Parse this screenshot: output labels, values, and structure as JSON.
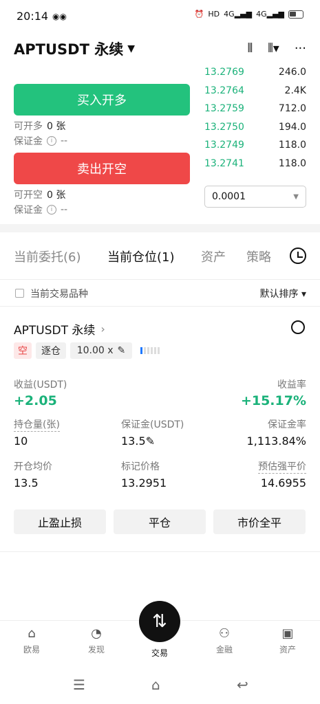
{
  "status": {
    "time": "20:14",
    "net1": "4G",
    "net2": "4G",
    "hd": "HD"
  },
  "header": {
    "pair": "APTUSDT 永续",
    "more": "···"
  },
  "trade": {
    "buy_label": "买入开多",
    "sell_label": "卖出开空",
    "can_open_long_label": "可开多",
    "can_open_long_val": "0 张",
    "can_open_short_label": "可开空",
    "can_open_short_val": "0 张",
    "margin_label": "保证金",
    "margin_val": "--"
  },
  "orderbook": [
    {
      "price": "13.2769",
      "qty": "246.0"
    },
    {
      "price": "13.2764",
      "qty": "2.4K"
    },
    {
      "price": "13.2759",
      "qty": "712.0"
    },
    {
      "price": "13.2750",
      "qty": "194.0"
    },
    {
      "price": "13.2749",
      "qty": "118.0"
    },
    {
      "price": "13.2741",
      "qty": "118.0"
    }
  ],
  "step": "0.0001",
  "tabs": [
    "当前委托(6)",
    "当前仓位(1)",
    "资产",
    "策略"
  ],
  "filter": {
    "label": "当前交易品种",
    "sort": "默认排序 ▾"
  },
  "position": {
    "title": "APTUSDT 永续",
    "side": "空",
    "margin_mode": "逐仓",
    "leverage": "10.00 x",
    "pnl_label": "收益(USDT)",
    "pnl": "+2.05",
    "roe_label": "收益率",
    "roe": "+15.17%",
    "size_label": "持仓量(张)",
    "size": "10",
    "margin_label": "保证金(USDT)",
    "margin": "13.5",
    "margin_ratio_label": "保证金率",
    "margin_ratio": "1,113.84%",
    "entry_label": "开仓均价",
    "entry": "13.5",
    "mark_label": "标记价格",
    "mark": "13.2951",
    "liq_label": "预估强平价",
    "liq": "14.6955"
  },
  "actions": {
    "tpsl": "止盈止损",
    "close": "平仓",
    "close_all": "市价全平"
  },
  "nav": [
    {
      "label": "欧易",
      "icon": "home-icon"
    },
    {
      "label": "发现",
      "icon": "discover-icon"
    },
    {
      "label": "交易",
      "icon": "trade-icon"
    },
    {
      "label": "金融",
      "icon": "finance-icon"
    },
    {
      "label": "资产",
      "icon": "wallet-icon"
    }
  ],
  "colors": {
    "buy": "#23c27d",
    "sell": "#ef4848",
    "green_text": "#1bb27a"
  }
}
